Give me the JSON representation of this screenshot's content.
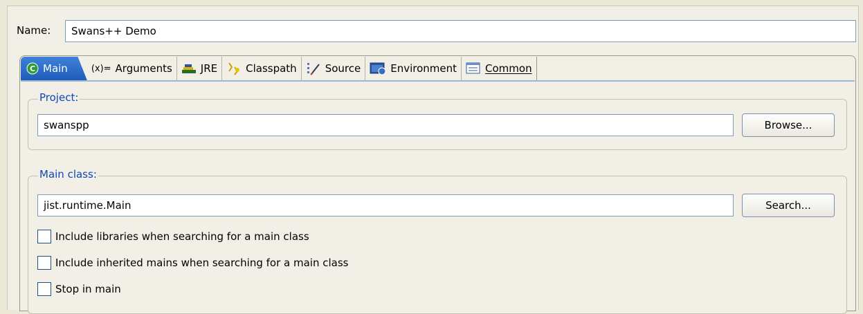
{
  "name": {
    "label": "Name:",
    "value": "Swans++ Demo"
  },
  "tabs": [
    {
      "label": "Main",
      "icon": "main-class-icon",
      "active": true
    },
    {
      "label": "Arguments",
      "icon": "arguments-icon",
      "prefix": "(x)="
    },
    {
      "label": "JRE",
      "icon": "jre-icon"
    },
    {
      "label": "Classpath",
      "icon": "classpath-icon"
    },
    {
      "label": "Source",
      "icon": "source-icon"
    },
    {
      "label": "Environment",
      "icon": "environment-icon"
    },
    {
      "label": "Common",
      "icon": "common-icon"
    }
  ],
  "project": {
    "title": "Project:",
    "value": "swanspp",
    "button": "Browse..."
  },
  "main_class": {
    "title": "Main class:",
    "value": "jist.runtime.Main",
    "button": "Search...",
    "options": [
      {
        "label": "Include libraries when searching for a main class",
        "checked": false
      },
      {
        "label": "Include inherited mains when searching for a main class",
        "checked": false
      },
      {
        "label": "Stop in main",
        "checked": false
      }
    ]
  },
  "colors": {
    "accent": "#0b48b8",
    "active_tab": "#2f6fc8",
    "background": "#ece9d8"
  }
}
